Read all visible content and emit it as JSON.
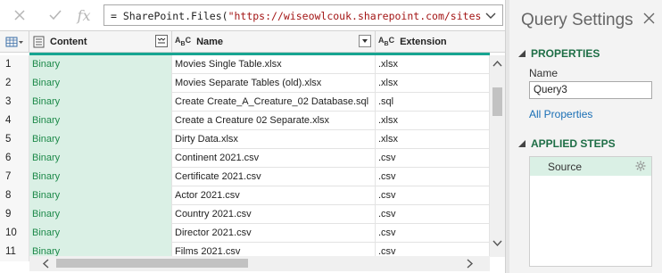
{
  "formula_bar": {
    "prefix": "= SharePoint.Files(",
    "string": "\"https://wiseowlcouk.sharepoint.com/sites/",
    "fx_label": "fx"
  },
  "columns": {
    "content": "Content",
    "name": "Name",
    "extension": "Extension",
    "type_abc": "ABC",
    "type_abc_sub": "ABC"
  },
  "rows": [
    {
      "idx": "1",
      "content": "Binary",
      "name": "Movies Single Table.xlsx",
      "ext": ".xlsx"
    },
    {
      "idx": "2",
      "content": "Binary",
      "name": "Movies Separate Tables (old).xlsx",
      "ext": ".xlsx"
    },
    {
      "idx": "3",
      "content": "Binary",
      "name": "Create Create_A_Creature_02 Database.sql",
      "ext": ".sql"
    },
    {
      "idx": "4",
      "content": "Binary",
      "name": "Create a Creature 02 Separate.xlsx",
      "ext": ".xlsx"
    },
    {
      "idx": "5",
      "content": "Binary",
      "name": "Dirty Data.xlsx",
      "ext": ".xlsx"
    },
    {
      "idx": "6",
      "content": "Binary",
      "name": "Continent 2021.csv",
      "ext": ".csv"
    },
    {
      "idx": "7",
      "content": "Binary",
      "name": "Certificate 2021.csv",
      "ext": ".csv"
    },
    {
      "idx": "8",
      "content": "Binary",
      "name": "Actor 2021.csv",
      "ext": ".csv"
    },
    {
      "idx": "9",
      "content": "Binary",
      "name": "Country 2021.csv",
      "ext": ".csv"
    },
    {
      "idx": "10",
      "content": "Binary",
      "name": "Director 2021.csv",
      "ext": ".csv"
    },
    {
      "idx": "11",
      "content": "Binary",
      "name": "Films 2021.csv",
      "ext": ".csv"
    }
  ],
  "query_settings": {
    "title": "Query Settings",
    "properties_heading": "PROPERTIES",
    "name_label": "Name",
    "name_value": "Query3",
    "all_properties": "All Properties",
    "applied_steps_heading": "APPLIED STEPS",
    "steps": [
      "Source"
    ]
  },
  "colors": {
    "accent_teal": "#17a591",
    "content_bg": "#daf0e5",
    "binary_text": "#1e8a4a",
    "heading_green": "#1e6e46",
    "link_blue": "#1a6fb5",
    "string_red": "#a31515"
  },
  "icons": [
    "cancel-icon",
    "commit-icon",
    "fx-icon",
    "chevron-down-icon",
    "table-menu-icon",
    "binary-column-icon",
    "expand-binary-icon",
    "text-type-icon",
    "filter-dropdown-icon",
    "close-icon",
    "triangle-icon",
    "gear-icon"
  ]
}
